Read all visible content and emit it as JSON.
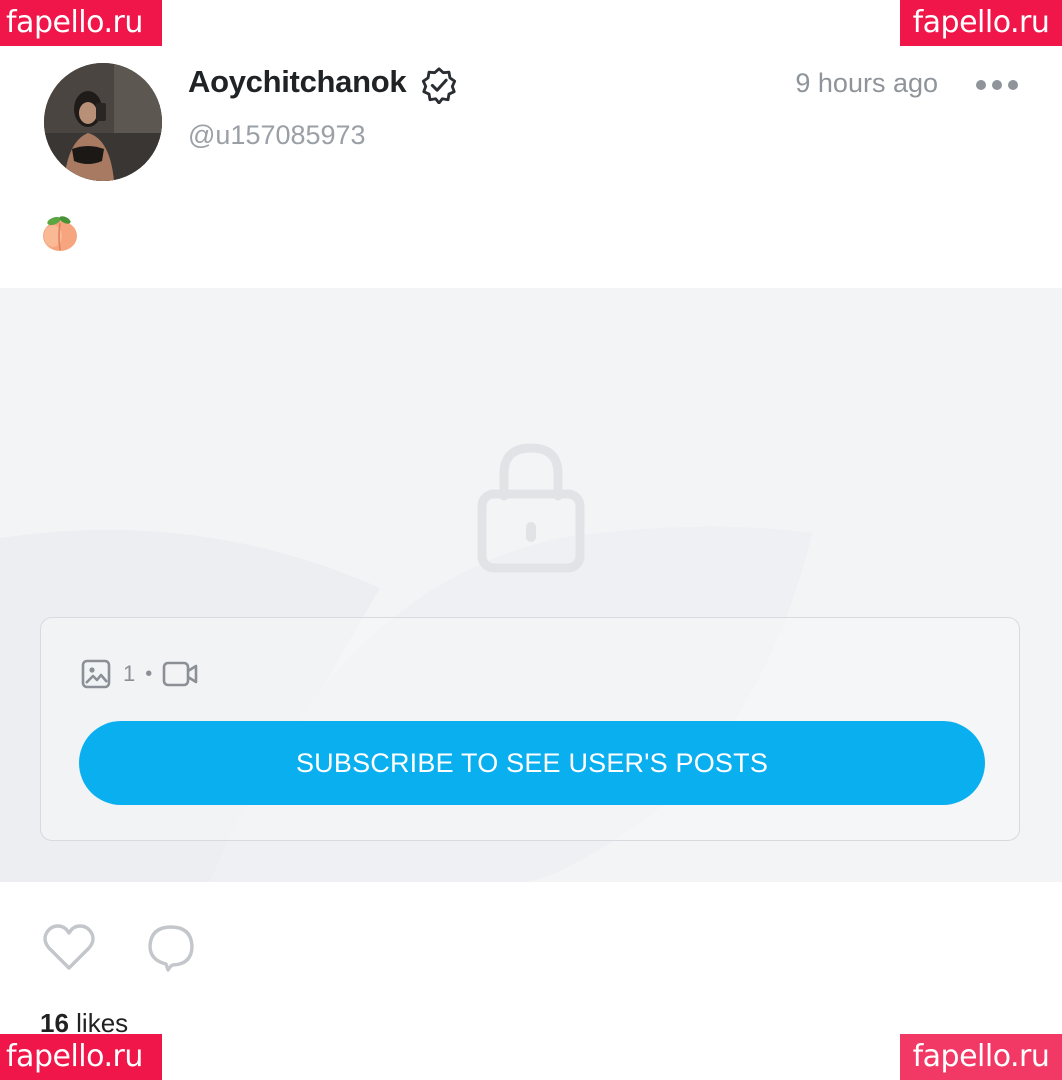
{
  "watermarks": {
    "top_left": "fapello.ru",
    "top_right": "fapello.ru",
    "bottom_left": "fapello.ru",
    "bottom_right": "fapello.ru"
  },
  "post": {
    "author": {
      "display_name": "Aoychitchanok",
      "handle": "@u157085973",
      "verified": true
    },
    "timestamp": "9 hours ago",
    "caption_emoji": "peach-emoji",
    "locked_content": {
      "image_count": "1",
      "separator": "•",
      "subscribe_label": "SUBSCRIBE TO SEE USER'S POSTS"
    },
    "likes": {
      "count": "16",
      "label": "likes"
    }
  },
  "colors": {
    "watermark": "#f0164a",
    "button": "#0aaff0",
    "muted_text": "#9aa0a6",
    "locked_bg": "#f3f4f6"
  }
}
